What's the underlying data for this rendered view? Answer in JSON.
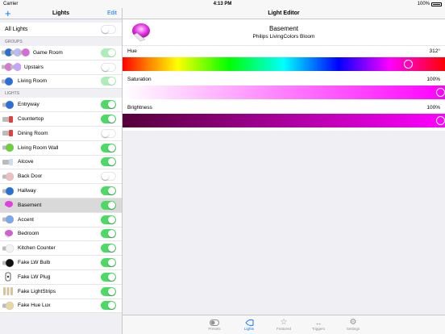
{
  "status_bar": {
    "carrier": "Carrier",
    "time": "4:13 PM",
    "battery": "100%"
  },
  "sidebar": {
    "add_label": "+",
    "title": "Lights",
    "edit_label": "Edit",
    "all_lights": {
      "label": "All Lights",
      "on": false
    },
    "groups_header": "GROUPS",
    "groups": [
      {
        "label": "Game Room",
        "on": true,
        "faded": true,
        "icon": "multi-bulb-icon",
        "colors": [
          "#2a6fd6",
          "#bbbbff",
          "#d36bd8"
        ]
      },
      {
        "label": "Upstairs",
        "on": false,
        "faded": false,
        "icon": "multi-bulb-icon",
        "colors": [
          "#d67ad0",
          "#c6a3ff"
        ]
      },
      {
        "label": "Living Room",
        "on": true,
        "faded": true,
        "icon": "bulb-icon",
        "colors": [
          "#2a6fd6"
        ]
      }
    ],
    "lights_header": "LIGHTS",
    "lights": [
      {
        "label": "Entryway",
        "on": true,
        "icon": "bulb-icon",
        "color": "#2a6fd6"
      },
      {
        "label": "Countertop",
        "on": true,
        "icon": "spot-icon",
        "color": "#e0413e"
      },
      {
        "label": "Dining Room",
        "on": false,
        "icon": "spot-icon",
        "color": "#e0413e"
      },
      {
        "label": "Living Room Wall",
        "on": true,
        "icon": "bulb-icon",
        "color": "#6bd13a"
      },
      {
        "label": "Alcove",
        "on": true,
        "icon": "spot-icon",
        "color": "#ccddee"
      },
      {
        "label": "Back Door",
        "on": false,
        "icon": "bulb-icon",
        "color": "#f0c0c0"
      },
      {
        "label": "Hallway",
        "on": true,
        "icon": "bulb-icon",
        "color": "#2a6fd6"
      },
      {
        "label": "Basement",
        "on": true,
        "icon": "bloom-icon",
        "color": "#e040e0",
        "selected": true
      },
      {
        "label": "Accent",
        "on": true,
        "icon": "bulb-icon",
        "color": "#7aa8f0"
      },
      {
        "label": "Bedroom",
        "on": true,
        "icon": "bloom-icon",
        "color": "#d060d0"
      },
      {
        "label": "Kitchen Counter",
        "on": true,
        "icon": "bulb-icon",
        "color": "#f3f3f3"
      },
      {
        "label": "Fake LW Bulb",
        "on": true,
        "icon": "bulb-icon",
        "color": "#111111"
      },
      {
        "label": "Fake LW Plug",
        "on": true,
        "icon": "plug-icon",
        "color": "#dddddd"
      },
      {
        "label": "Fake LightStrips",
        "on": true,
        "icon": "strip-icon",
        "color": "#d4c69a"
      },
      {
        "label": "Fake Hue Lux",
        "on": true,
        "icon": "bulb-icon",
        "color": "#e8d8a0"
      }
    ]
  },
  "editor": {
    "title": "Light Editor",
    "light_name": "Basement",
    "light_model": "Philips LivingColors Bloom",
    "sliders": [
      {
        "key": "hue",
        "label": "Hue",
        "value_text": "312°",
        "fraction": 0.885,
        "knob_color": "#ff00c0"
      },
      {
        "key": "saturation",
        "label": "Saturation",
        "value_text": "100%",
        "fraction": 1.0,
        "knob_color": "#ff00ff"
      },
      {
        "key": "brightness",
        "label": "Brightness",
        "value_text": "100%",
        "fraction": 1.0,
        "knob_color": "#ff00ff"
      }
    ]
  },
  "tabbar": {
    "tabs": [
      {
        "label": "Presets",
        "icon": "toggle-icon",
        "active": false
      },
      {
        "label": "Lights",
        "icon": "bloom-icon",
        "active": true
      },
      {
        "label": "Featured",
        "icon": "star-icon",
        "active": false
      },
      {
        "label": "Triggers",
        "icon": "arrows-icon",
        "active": false
      },
      {
        "label": "Settings",
        "icon": "gear-icon",
        "active": false
      }
    ]
  }
}
